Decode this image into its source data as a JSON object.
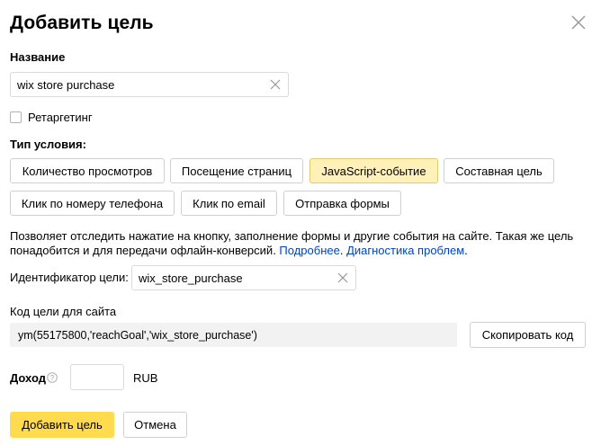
{
  "dialog": {
    "title": "Добавить цель"
  },
  "name_field": {
    "label": "Название",
    "value": "wix store purchase"
  },
  "retargeting": {
    "label": "Ретаргетинг",
    "checked": false
  },
  "condition": {
    "label": "Тип условия:",
    "options": [
      "Количество просмотров",
      "Посещение страниц",
      "JavaScript-событие",
      "Составная цель",
      "Клик по номеру телефона",
      "Клик по email",
      "Отправка формы"
    ],
    "selected": "JavaScript-событие"
  },
  "description": {
    "text": "Позволяет отследить нажатие на кнопку, заполнение формы и другие события на сайте. Такая же цель понадобится и для передачи офлайн-конверсий. ",
    "link_more": "Подробнее",
    "separator": ". ",
    "link_diag": "Диагностика проблем",
    "end": "."
  },
  "goal_id": {
    "label": "Идентификатор цели:",
    "value": "wix_store_purchase"
  },
  "code": {
    "label": "Код цели для сайта",
    "value": "ym(55175800,'reachGoal','wix_store_purchase')",
    "copy_button": "Скопировать код"
  },
  "income": {
    "label": "Доход",
    "value": "",
    "currency": "RUB"
  },
  "actions": {
    "submit": "Добавить цель",
    "cancel": "Отмена"
  },
  "colors": {
    "selected_option_bg": "#fff1b8",
    "primary_button_bg": "#ffdb4d",
    "link": "#0044bb"
  }
}
